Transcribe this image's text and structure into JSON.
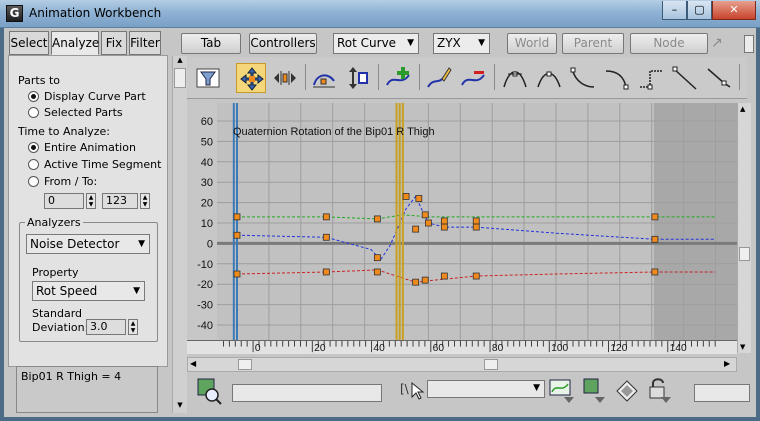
{
  "window": {
    "title": "Animation Workbench",
    "app_icon_letter": "G",
    "buttons": {
      "minimize": "–",
      "maximize": "▢",
      "close": "✕"
    }
  },
  "left_tabs": [
    {
      "label": "Select",
      "active": false
    },
    {
      "label": "Analyze",
      "active": true
    },
    {
      "label": "Fix",
      "active": false
    },
    {
      "label": "Filter",
      "active": false
    }
  ],
  "parts_to": {
    "label": "Parts to",
    "options": [
      {
        "label": "Display Curve Part",
        "checked": true
      },
      {
        "label": "Selected Parts",
        "checked": false
      }
    ]
  },
  "time_to_analyze": {
    "label": "Time to Analyze:",
    "options": [
      {
        "label": "Entire Animation",
        "checked": true
      },
      {
        "label": "Active Time Segment",
        "checked": false
      },
      {
        "label": "From / To:",
        "checked": false
      }
    ],
    "from_value": "0",
    "to_value": "123"
  },
  "analyzers": {
    "label": "Analyzers",
    "selected": "Noise Detector",
    "property_label": "Property",
    "property_selected": "Rot Speed",
    "std_dev_label_1": "Standard",
    "std_dev_label_2": "Deviation:",
    "std_dev_value": "3.0"
  },
  "status_text": "Bip01 R Thigh = 4",
  "toolbar": {
    "tab_label": "Tab",
    "controllers_label": "Controllers",
    "curve_combo": "Rot Curve",
    "order_combo": "ZYX",
    "world_label": "World",
    "parent_label": "Parent",
    "node_label": "Node"
  },
  "icons": {
    "filter": "filter-icon",
    "move": "move-keys-icon",
    "slide": "slide-keys-icon",
    "scale_keys": "scale-keys-icon",
    "scale_values": "scale-values-icon",
    "add_key": "add-key-icon",
    "draw_curve": "draw-curve-icon",
    "delete_key": "delete-key-icon",
    "tangents": [
      "tangent-auto-icon",
      "tangent-smooth-icon",
      "tangent-fast-icon",
      "tangent-slow-icon",
      "tangent-step-icon",
      "tangent-linear-icon",
      "tangent-custom-icon"
    ]
  },
  "graph": {
    "title": "Quaternion Rotation of the Bip01 R Thigh",
    "y_ticks": [
      "60",
      "50",
      "40",
      "30",
      "20",
      "10",
      "0",
      "-10",
      "-20",
      "-30",
      "-40"
    ],
    "x_ticks": [
      "0",
      "20",
      "40",
      "60",
      "80",
      "100",
      "120",
      "140"
    ],
    "colors": {
      "bg": "#c1c1c1",
      "bg_out": "#a8a8a8",
      "grid": "#9e9e9e",
      "x_curve": "#cc2222",
      "y_curve": "#22aa22",
      "z_curve": "#2233dd",
      "key": "#f08a1c",
      "time_marker": "#c8a020",
      "blue_marker": "#3a7ab8"
    }
  }
}
